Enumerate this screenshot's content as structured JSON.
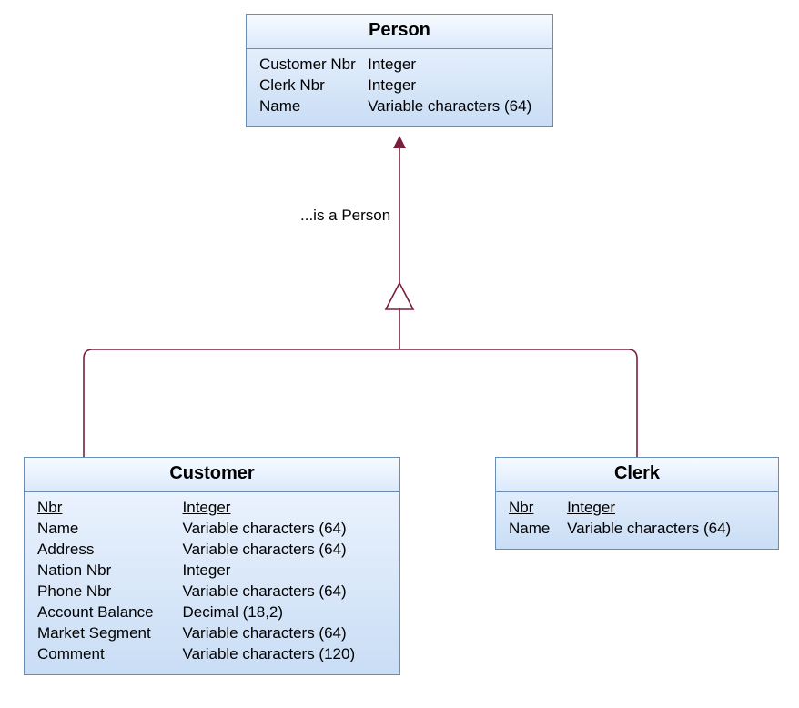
{
  "relationship_label": "...is a Person",
  "colors": {
    "line": "#7a1f3a",
    "border": "#6a8db5"
  },
  "entities": {
    "person": {
      "title": "Person",
      "attrs": [
        {
          "name": "Customer Nbr",
          "type": "Integer",
          "pk": false
        },
        {
          "name": "Clerk Nbr",
          "type": "Integer",
          "pk": false
        },
        {
          "name": "Name",
          "type": "Variable characters (64)",
          "pk": false
        }
      ]
    },
    "customer": {
      "title": "Customer",
      "attrs": [
        {
          "name": "Nbr",
          "type": "Integer",
          "pk": true
        },
        {
          "name": "Name",
          "type": "Variable characters (64)",
          "pk": false
        },
        {
          "name": "Address",
          "type": "Variable characters (64)",
          "pk": false
        },
        {
          "name": "Nation Nbr",
          "type": "Integer",
          "pk": false
        },
        {
          "name": "Phone Nbr",
          "type": "Variable characters (64)",
          "pk": false
        },
        {
          "name": "Account Balance",
          "type": "Decimal (18,2)",
          "pk": false
        },
        {
          "name": "Market Segment",
          "type": "Variable characters (64)",
          "pk": false
        },
        {
          "name": "Comment",
          "type": "Variable characters (120)",
          "pk": false
        }
      ]
    },
    "clerk": {
      "title": "Clerk",
      "attrs": [
        {
          "name": "Nbr",
          "type": "Integer",
          "pk": true
        },
        {
          "name": "Name",
          "type": "Variable characters (64)",
          "pk": false
        }
      ]
    }
  }
}
